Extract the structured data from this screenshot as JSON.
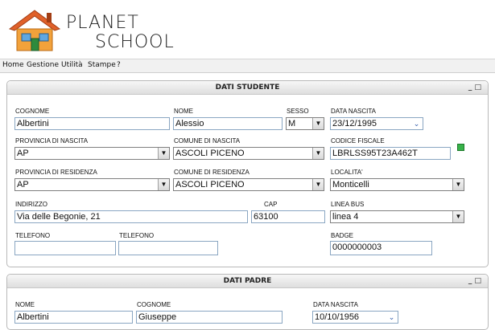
{
  "app": {
    "logo_line1": "PLANET",
    "logo_line2": "SCHOOL"
  },
  "menu": [
    "Home",
    "Gestione",
    "Utilità",
    "Stampe",
    "?"
  ],
  "panel_studente": {
    "title": "DATI STUDENTE",
    "controls": "_ □",
    "labels": {
      "cognome": "COGNOME",
      "nome": "NOME",
      "sesso": "SESSO",
      "data_nascita": "DATA NASCITA",
      "provincia_nascita": "PROVINCIA DI NASCITA",
      "comune_nascita": "COMUNE DI NASCITA",
      "codice_fiscale": "CODICE FISCALE",
      "provincia_residenza": "PROVINCIA DI RESIDENZA",
      "comune_residenza": "COMUNE DI RESIDENZA",
      "localita": "LOCALITA'",
      "indirizzo": "INDIRIZZO",
      "cap": "CAP",
      "linea_bus": "LINEA BUS",
      "telefono1": "TELEFONO",
      "telefono2": "TELEFONO",
      "badge": "BADGE"
    },
    "values": {
      "cognome": "Albertini",
      "nome": "Alessio",
      "sesso": "M",
      "data_nascita": "23/12/1995",
      "provincia_nascita": "AP",
      "comune_nascita": "ASCOLI PICENO",
      "codice_fiscale": "LBRLSS95T23A462T",
      "provincia_residenza": "AP",
      "comune_residenza": "ASCOLI PICENO",
      "localita": "Monticelli",
      "indirizzo": "Via delle Begonie, 21",
      "cap": "63100",
      "linea_bus": "linea 4",
      "telefono1": "",
      "telefono2": "",
      "badge": "0000000003"
    }
  },
  "panel_padre": {
    "title": "DATI PADRE",
    "controls": "_ □",
    "labels": {
      "nome": "NOME",
      "cognome": "COGNOME",
      "data_nascita": "DATA NASCITA"
    },
    "values": {
      "nome": "Albertini",
      "cognome": "Giuseppe",
      "data_nascita": "10/10/1956"
    }
  },
  "colors": {
    "field_border": "#8aa6c2",
    "panel_header": "#dedede",
    "cf_icon": "#38b24a"
  }
}
